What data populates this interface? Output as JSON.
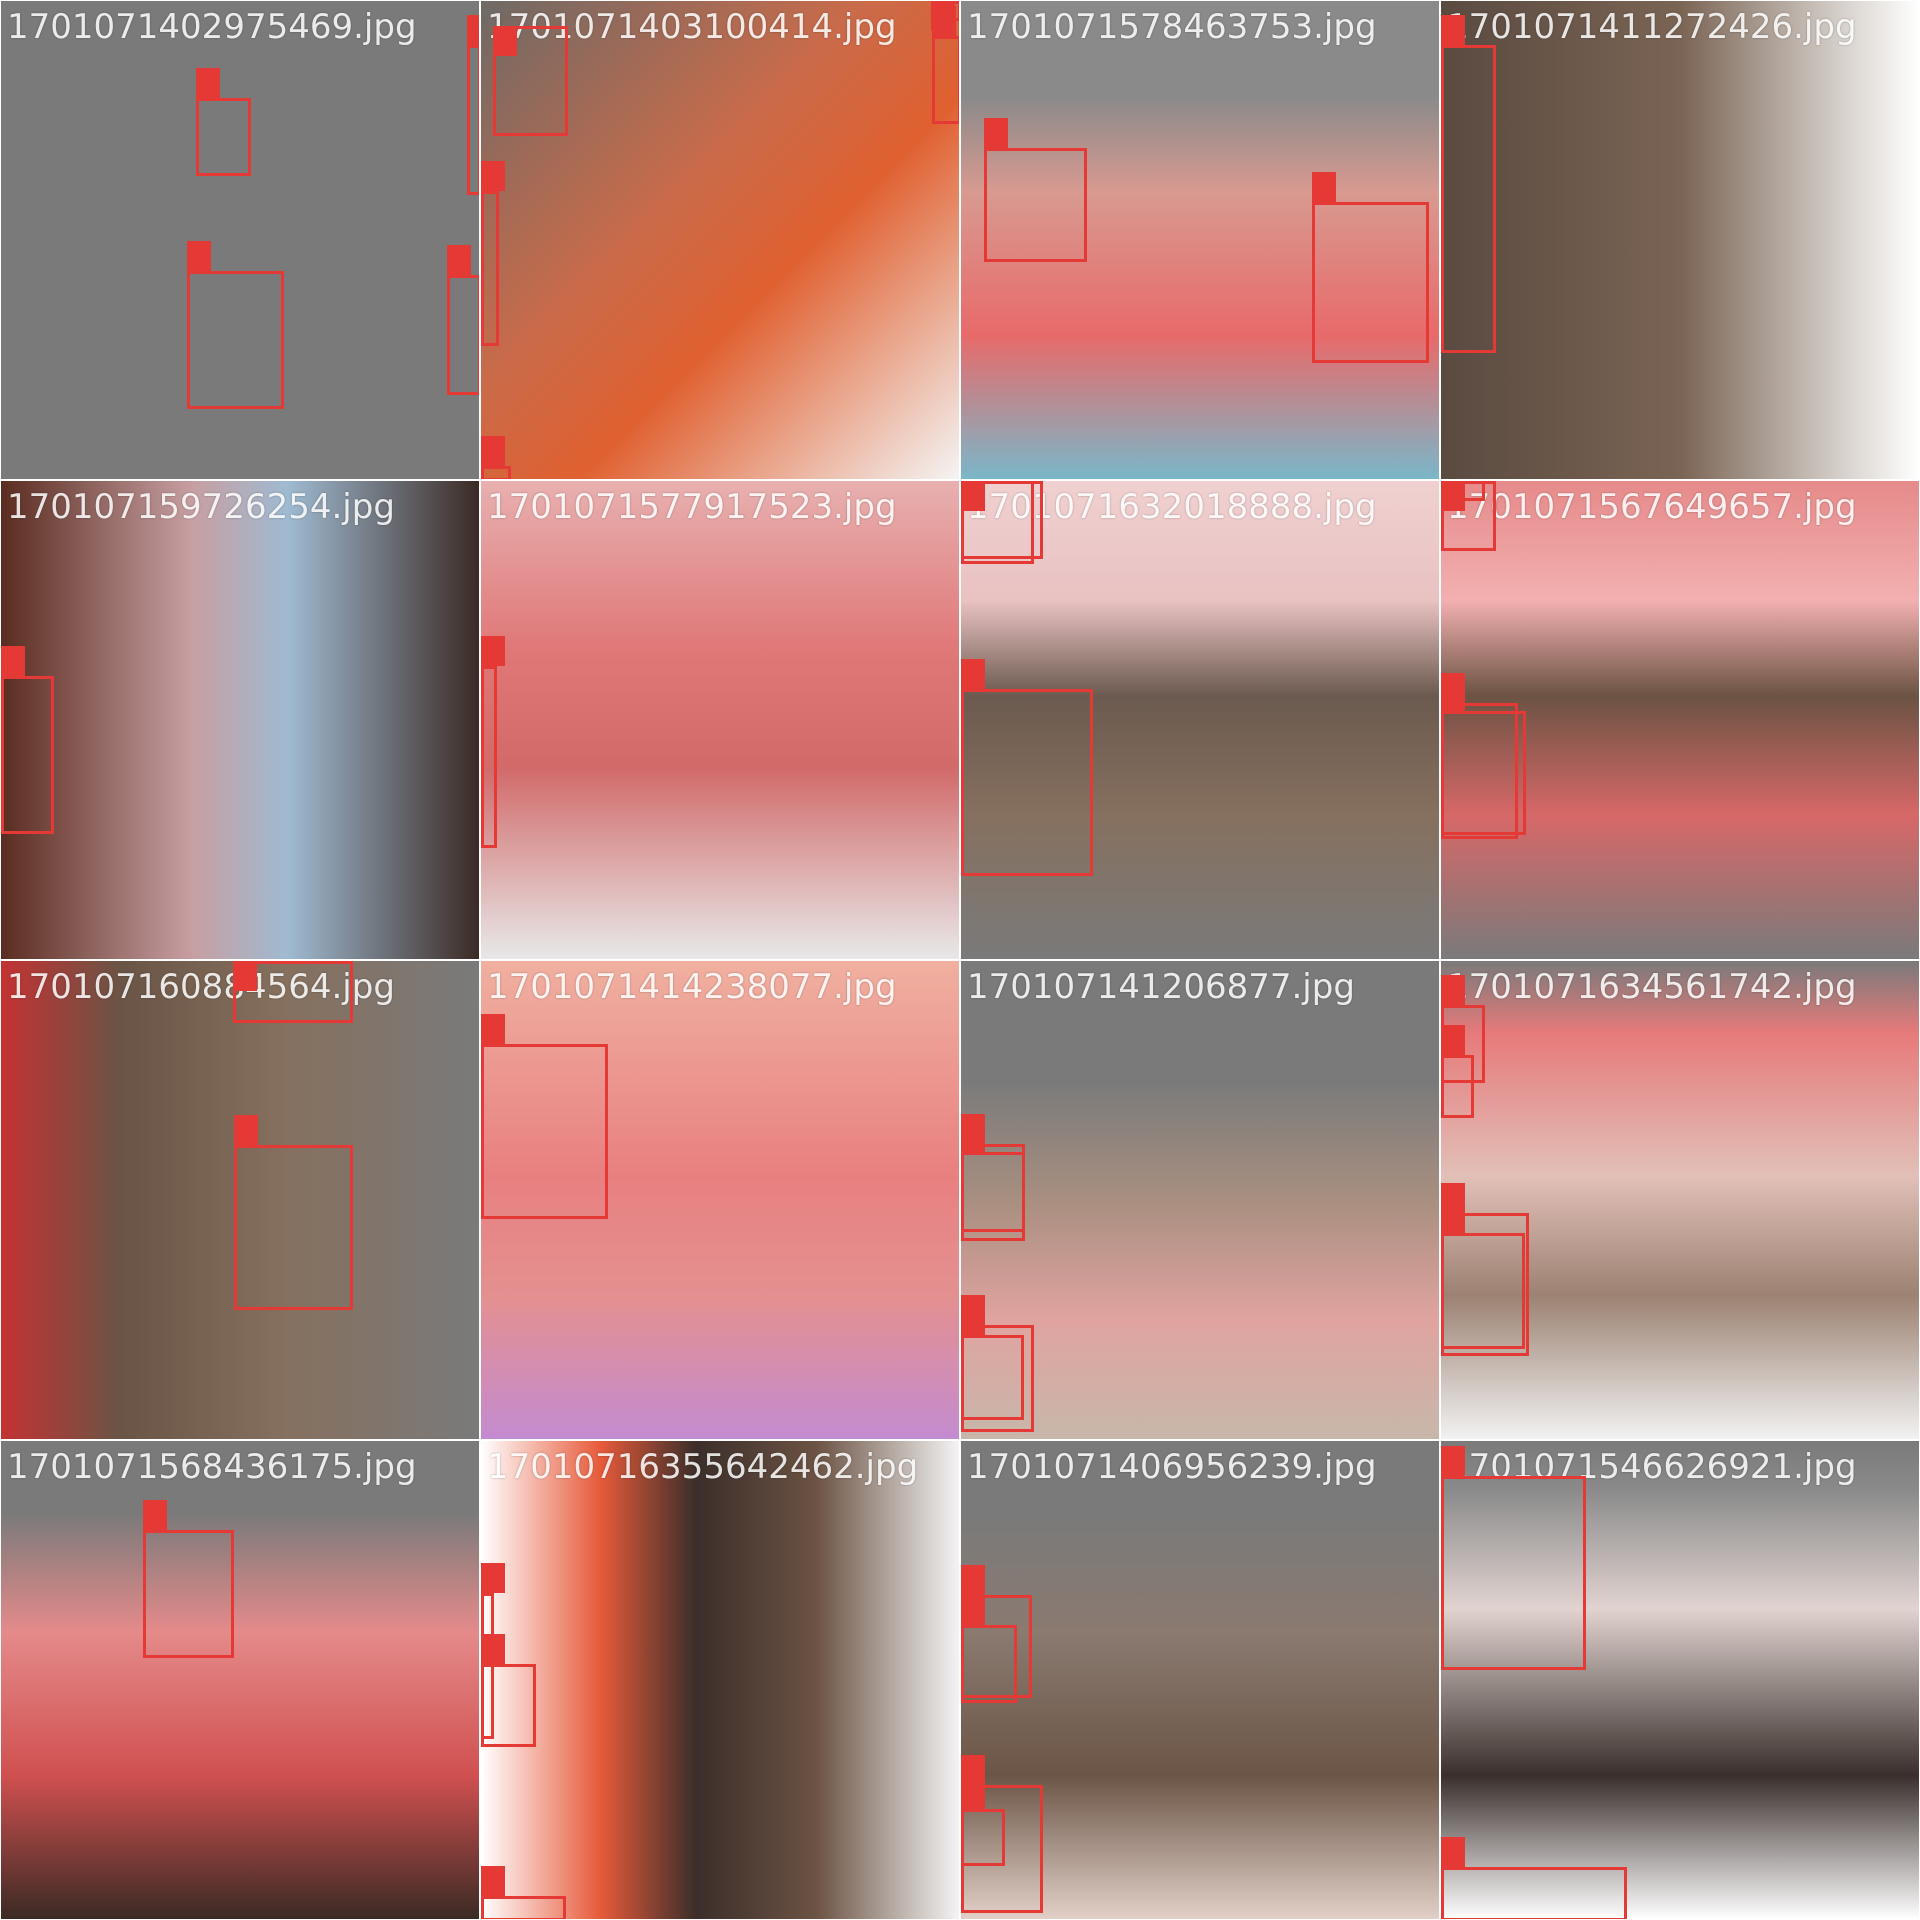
{
  "colors": {
    "box": "#e53935",
    "tile_bg": "#7d7d7d"
  },
  "tiles": [
    {
      "name": "1701071402975469.jpg",
      "boxes": [
        "0",
        "0",
        "0",
        "0"
      ]
    },
    {
      "name": "1701071403100414.jpg",
      "boxes": [
        "0",
        "0",
        "0",
        "0",
        "0"
      ]
    },
    {
      "name": "1701071578463753.jpg",
      "boxes": [
        "0",
        "0"
      ]
    },
    {
      "name": "1701071411272426.jpg",
      "boxes": [
        "0"
      ]
    },
    {
      "name": "170107159726254.jpg",
      "boxes": [
        "0"
      ]
    },
    {
      "name": "1701071577917523.jpg",
      "boxes": [
        "0"
      ]
    },
    {
      "name": "1701071632018888.jpg",
      "boxes": [
        "0",
        "0",
        "0"
      ]
    },
    {
      "name": "1701071567649657.jpg",
      "boxes": [
        "0",
        "0",
        "0",
        "0"
      ]
    },
    {
      "name": "170107160884564.jpg",
      "boxes": [
        "0",
        "0"
      ]
    },
    {
      "name": "1701071414238077.jpg",
      "boxes": [
        "0"
      ]
    },
    {
      "name": "170107141206877.jpg",
      "boxes": [
        "0",
        "0",
        "0",
        "0"
      ]
    },
    {
      "name": "1701071634561742.jpg",
      "boxes": [
        "0",
        "0",
        "0",
        "0"
      ]
    },
    {
      "name": "1701071568436175.jpg",
      "boxes": [
        "0"
      ]
    },
    {
      "name": "17010716355642462.jpg",
      "boxes": [
        "0",
        "0",
        "0"
      ]
    },
    {
      "name": "1701071406956239.jpg",
      "boxes": [
        "0",
        "0",
        "0",
        "0"
      ]
    },
    {
      "name": "1701071546626921.jpg",
      "boxes": [
        "0",
        "0"
      ]
    }
  ]
}
